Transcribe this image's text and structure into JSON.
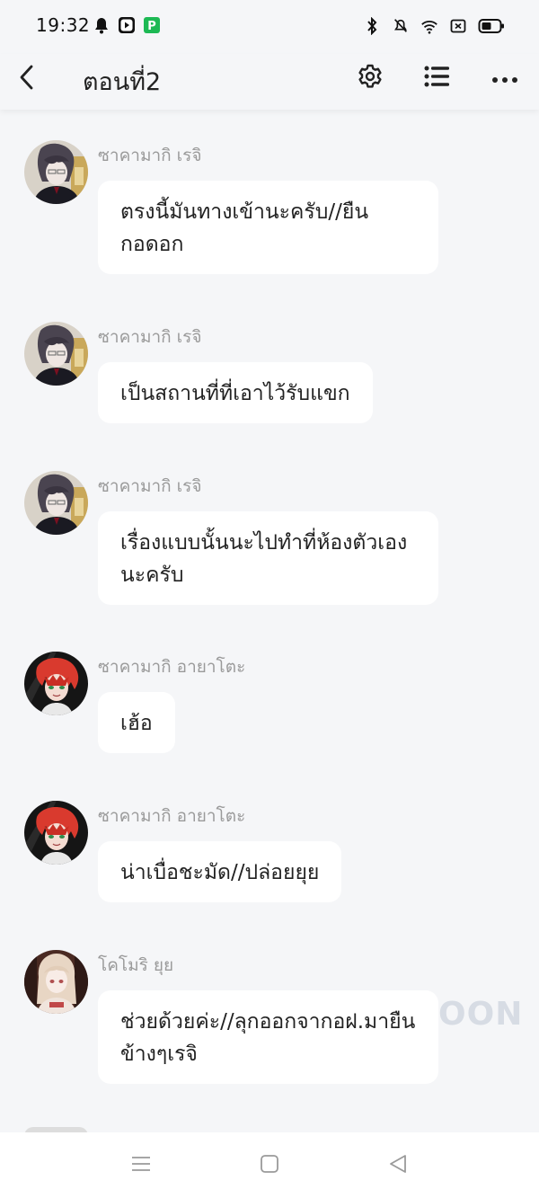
{
  "status_bar": {
    "time": "19:32",
    "left_icons": [
      "notification-bell-icon",
      "video-app-icon",
      "payment-app-icon"
    ],
    "right_icons": [
      "bluetooth-icon",
      "muted-bell-icon",
      "wifi-icon",
      "sim-icon",
      "battery-icon"
    ]
  },
  "app_bar": {
    "title": "ตอนที่2",
    "icons": [
      "back-icon",
      "settings-icon",
      "list-icon",
      "more-icon"
    ]
  },
  "messages": [
    {
      "sender": "ซาคามากิ เรจิ",
      "text": "ตรงนี้มันทางเข้านะครับ//ยืนกอดอก",
      "avatar": "dark-haired-avatar"
    },
    {
      "sender": "ซาคามากิ เรจิ",
      "text": "เป็นสถานที่ที่เอาไว้รับแขก",
      "avatar": "dark-haired-avatar"
    },
    {
      "sender": "ซาคามากิ เรจิ",
      "text": "เรื่องแบบนั้นนะไปทำที่ห้องตัวเองนะครับ",
      "avatar": "dark-haired-avatar"
    },
    {
      "sender": "ซาคามากิ อายาโตะ",
      "text": "เฮ้อ",
      "avatar": "red-haired-avatar"
    },
    {
      "sender": "ซาคามากิ อายาโตะ",
      "text": "น่าเบื่อชะมัด//ปล่อยยุย",
      "avatar": "red-haired-avatar"
    },
    {
      "sender": "โคโมริ ยุย",
      "text": "ช่วยด้วยค่ะ//ลุกออกจากอฝ.มายืนข้างๆเรจิ",
      "avatar": "blonde-haired-avatar"
    }
  ],
  "watermark": "OON",
  "nav_bar": {
    "icons": [
      "menu-icon",
      "home-icon",
      "back-triangle-icon"
    ]
  }
}
